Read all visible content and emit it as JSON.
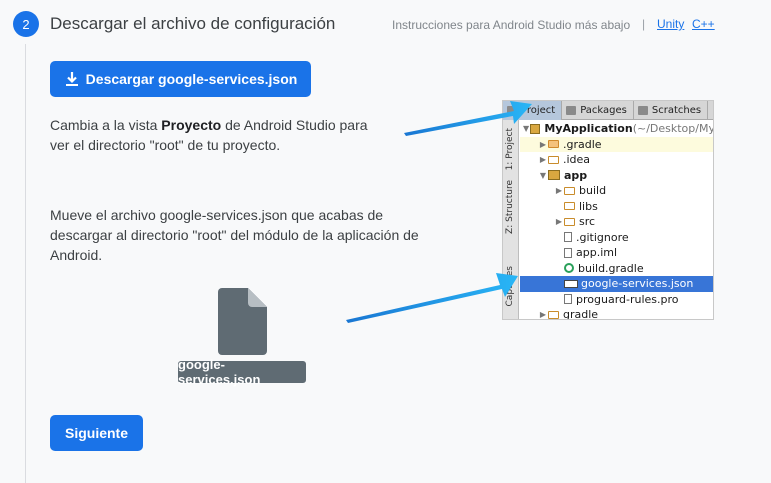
{
  "step": {
    "number": "2",
    "title": "Descargar el archivo de configuración",
    "instructions_note": "Instrucciones para Android Studio más abajo",
    "separator": "|",
    "links": {
      "unity": "Unity",
      "cpp": "C++"
    }
  },
  "download_button": {
    "label": "Descargar google-services.json",
    "icon": "download-icon"
  },
  "paragraph1": {
    "before": "Cambia a la vista ",
    "bold": "Proyecto",
    "after": " de Android Studio para ver el directorio \"root\" de tu proyecto."
  },
  "paragraph2": {
    "text": "Mueve el archivo google-services.json que acabas de descargar al directorio \"root\" del módulo de la aplicación de Android."
  },
  "file": {
    "icon": "document-icon",
    "label": "google-services.json"
  },
  "next_button": {
    "label": "Siguiente"
  },
  "studio": {
    "tabs": [
      "Project",
      "Packages",
      "Scratches"
    ],
    "side_labels": [
      "1: Project",
      "Z: Structure",
      "Captures"
    ],
    "tree": [
      {
        "label": "MyApplication",
        "path": " (~/Desktop/My",
        "indent": 0,
        "arrow": "▼",
        "icon": "module",
        "bold": true
      },
      {
        "label": ".gradle",
        "indent": 1,
        "arrow": "▶",
        "icon": "folder-orange",
        "highlight": "yellow"
      },
      {
        "label": ".idea",
        "indent": 1,
        "arrow": "▶",
        "icon": "folder"
      },
      {
        "label": "app",
        "indent": 1,
        "arrow": "▼",
        "icon": "module",
        "bold": true
      },
      {
        "label": "build",
        "indent": 2,
        "arrow": "▶",
        "icon": "folder"
      },
      {
        "label": "libs",
        "indent": 2,
        "arrow": "",
        "icon": "folder"
      },
      {
        "label": "src",
        "indent": 2,
        "arrow": "▶",
        "icon": "folder"
      },
      {
        "label": ".gitignore",
        "indent": 2,
        "arrow": "",
        "icon": "file"
      },
      {
        "label": "app.iml",
        "indent": 2,
        "arrow": "",
        "icon": "file"
      },
      {
        "label": "build.gradle",
        "indent": 2,
        "arrow": "",
        "icon": "gradle"
      },
      {
        "label": "google-services.json",
        "indent": 2,
        "arrow": "",
        "icon": "json",
        "selected": true
      },
      {
        "label": "proguard-rules.pro",
        "indent": 2,
        "arrow": "",
        "icon": "file"
      },
      {
        "label": "gradle",
        "indent": 1,
        "arrow": "▶",
        "icon": "folder"
      }
    ]
  },
  "colors": {
    "accent": "#1a73e8",
    "arrow": "#1e88e5",
    "selection": "#3875d7"
  }
}
